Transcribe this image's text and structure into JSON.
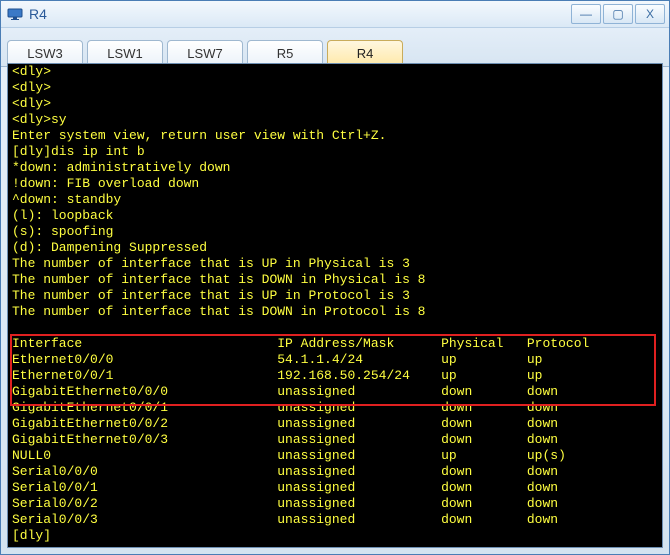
{
  "window": {
    "title": "R4"
  },
  "winControls": {
    "min": "—",
    "max": "▢",
    "close": "X"
  },
  "tabs": [
    {
      "label": "LSW3",
      "active": false
    },
    {
      "label": "LSW1",
      "active": false
    },
    {
      "label": "LSW7",
      "active": false
    },
    {
      "label": "R5",
      "active": false
    },
    {
      "label": "R4",
      "active": true
    }
  ],
  "terminal": {
    "lines": [
      "<dly>",
      "<dly>",
      "<dly>",
      "<dly>sy",
      "Enter system view, return user view with Ctrl+Z.",
      "[dly]dis ip int b",
      "*down: administratively down",
      "!down: FIB overload down",
      "^down: standby",
      "(l): loopback",
      "(s): spoofing",
      "(d): Dampening Suppressed",
      "The number of interface that is UP in Physical is 3",
      "The number of interface that is DOWN in Physical is 8",
      "The number of interface that is UP in Protocol is 3",
      "The number of interface that is DOWN in Protocol is 8",
      "",
      "Interface                         IP Address/Mask      Physical   Protocol",
      "Ethernet0/0/0                     54.1.1.4/24          up         up",
      "Ethernet0/0/1                     192.168.50.254/24    up         up",
      "GigabitEthernet0/0/0              unassigned           down       down",
      "GigabitEthernet0/0/1              unassigned           down       down",
      "GigabitEthernet0/0/2              unassigned           down       down",
      "GigabitEthernet0/0/3              unassigned           down       down",
      "NULL0                             unassigned           up         up(s)",
      "Serial0/0/0                       unassigned           down       down",
      "Serial0/0/1                       unassigned           down       down",
      "Serial0/0/2                       unassigned           down       down",
      "Serial0/0/3                       unassigned           down       down",
      "[dly]"
    ],
    "highlight": {
      "startLine": 17,
      "endLine": 20
    }
  },
  "chart_data": {
    "type": "table",
    "title": "dis ip int b",
    "columns": [
      "Interface",
      "IP Address/Mask",
      "Physical",
      "Protocol"
    ],
    "rows": [
      [
        "Ethernet0/0/0",
        "54.1.1.4/24",
        "up",
        "up"
      ],
      [
        "Ethernet0/0/1",
        "192.168.50.254/24",
        "up",
        "up"
      ],
      [
        "GigabitEthernet0/0/0",
        "unassigned",
        "down",
        "down"
      ],
      [
        "GigabitEthernet0/0/1",
        "unassigned",
        "down",
        "down"
      ],
      [
        "GigabitEthernet0/0/2",
        "unassigned",
        "down",
        "down"
      ],
      [
        "GigabitEthernet0/0/3",
        "unassigned",
        "down",
        "down"
      ],
      [
        "NULL0",
        "unassigned",
        "up",
        "up(s)"
      ],
      [
        "Serial0/0/0",
        "unassigned",
        "down",
        "down"
      ],
      [
        "Serial0/0/1",
        "unassigned",
        "down",
        "down"
      ],
      [
        "Serial0/0/2",
        "unassigned",
        "down",
        "down"
      ],
      [
        "Serial0/0/3",
        "unassigned",
        "down",
        "down"
      ]
    ],
    "summary": {
      "physical_up": 3,
      "physical_down": 8,
      "protocol_up": 3,
      "protocol_down": 8
    }
  }
}
